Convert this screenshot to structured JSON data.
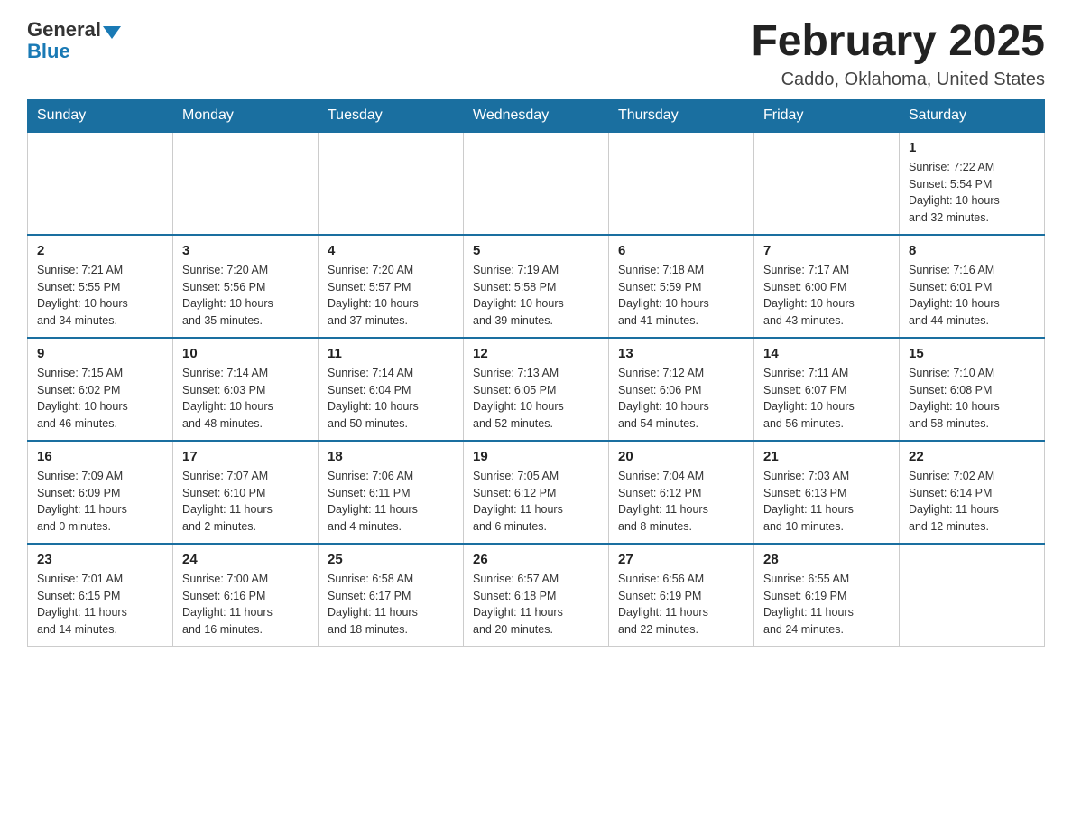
{
  "logo": {
    "general": "General",
    "blue": "Blue"
  },
  "title": "February 2025",
  "location": "Caddo, Oklahoma, United States",
  "days_of_week": [
    "Sunday",
    "Monday",
    "Tuesday",
    "Wednesday",
    "Thursday",
    "Friday",
    "Saturday"
  ],
  "weeks": [
    [
      {
        "day": "",
        "info": ""
      },
      {
        "day": "",
        "info": ""
      },
      {
        "day": "",
        "info": ""
      },
      {
        "day": "",
        "info": ""
      },
      {
        "day": "",
        "info": ""
      },
      {
        "day": "",
        "info": ""
      },
      {
        "day": "1",
        "info": "Sunrise: 7:22 AM\nSunset: 5:54 PM\nDaylight: 10 hours\nand 32 minutes."
      }
    ],
    [
      {
        "day": "2",
        "info": "Sunrise: 7:21 AM\nSunset: 5:55 PM\nDaylight: 10 hours\nand 34 minutes."
      },
      {
        "day": "3",
        "info": "Sunrise: 7:20 AM\nSunset: 5:56 PM\nDaylight: 10 hours\nand 35 minutes."
      },
      {
        "day": "4",
        "info": "Sunrise: 7:20 AM\nSunset: 5:57 PM\nDaylight: 10 hours\nand 37 minutes."
      },
      {
        "day": "5",
        "info": "Sunrise: 7:19 AM\nSunset: 5:58 PM\nDaylight: 10 hours\nand 39 minutes."
      },
      {
        "day": "6",
        "info": "Sunrise: 7:18 AM\nSunset: 5:59 PM\nDaylight: 10 hours\nand 41 minutes."
      },
      {
        "day": "7",
        "info": "Sunrise: 7:17 AM\nSunset: 6:00 PM\nDaylight: 10 hours\nand 43 minutes."
      },
      {
        "day": "8",
        "info": "Sunrise: 7:16 AM\nSunset: 6:01 PM\nDaylight: 10 hours\nand 44 minutes."
      }
    ],
    [
      {
        "day": "9",
        "info": "Sunrise: 7:15 AM\nSunset: 6:02 PM\nDaylight: 10 hours\nand 46 minutes."
      },
      {
        "day": "10",
        "info": "Sunrise: 7:14 AM\nSunset: 6:03 PM\nDaylight: 10 hours\nand 48 minutes."
      },
      {
        "day": "11",
        "info": "Sunrise: 7:14 AM\nSunset: 6:04 PM\nDaylight: 10 hours\nand 50 minutes."
      },
      {
        "day": "12",
        "info": "Sunrise: 7:13 AM\nSunset: 6:05 PM\nDaylight: 10 hours\nand 52 minutes."
      },
      {
        "day": "13",
        "info": "Sunrise: 7:12 AM\nSunset: 6:06 PM\nDaylight: 10 hours\nand 54 minutes."
      },
      {
        "day": "14",
        "info": "Sunrise: 7:11 AM\nSunset: 6:07 PM\nDaylight: 10 hours\nand 56 minutes."
      },
      {
        "day": "15",
        "info": "Sunrise: 7:10 AM\nSunset: 6:08 PM\nDaylight: 10 hours\nand 58 minutes."
      }
    ],
    [
      {
        "day": "16",
        "info": "Sunrise: 7:09 AM\nSunset: 6:09 PM\nDaylight: 11 hours\nand 0 minutes."
      },
      {
        "day": "17",
        "info": "Sunrise: 7:07 AM\nSunset: 6:10 PM\nDaylight: 11 hours\nand 2 minutes."
      },
      {
        "day": "18",
        "info": "Sunrise: 7:06 AM\nSunset: 6:11 PM\nDaylight: 11 hours\nand 4 minutes."
      },
      {
        "day": "19",
        "info": "Sunrise: 7:05 AM\nSunset: 6:12 PM\nDaylight: 11 hours\nand 6 minutes."
      },
      {
        "day": "20",
        "info": "Sunrise: 7:04 AM\nSunset: 6:12 PM\nDaylight: 11 hours\nand 8 minutes."
      },
      {
        "day": "21",
        "info": "Sunrise: 7:03 AM\nSunset: 6:13 PM\nDaylight: 11 hours\nand 10 minutes."
      },
      {
        "day": "22",
        "info": "Sunrise: 7:02 AM\nSunset: 6:14 PM\nDaylight: 11 hours\nand 12 minutes."
      }
    ],
    [
      {
        "day": "23",
        "info": "Sunrise: 7:01 AM\nSunset: 6:15 PM\nDaylight: 11 hours\nand 14 minutes."
      },
      {
        "day": "24",
        "info": "Sunrise: 7:00 AM\nSunset: 6:16 PM\nDaylight: 11 hours\nand 16 minutes."
      },
      {
        "day": "25",
        "info": "Sunrise: 6:58 AM\nSunset: 6:17 PM\nDaylight: 11 hours\nand 18 minutes."
      },
      {
        "day": "26",
        "info": "Sunrise: 6:57 AM\nSunset: 6:18 PM\nDaylight: 11 hours\nand 20 minutes."
      },
      {
        "day": "27",
        "info": "Sunrise: 6:56 AM\nSunset: 6:19 PM\nDaylight: 11 hours\nand 22 minutes."
      },
      {
        "day": "28",
        "info": "Sunrise: 6:55 AM\nSunset: 6:19 PM\nDaylight: 11 hours\nand 24 minutes."
      },
      {
        "day": "",
        "info": ""
      }
    ]
  ]
}
